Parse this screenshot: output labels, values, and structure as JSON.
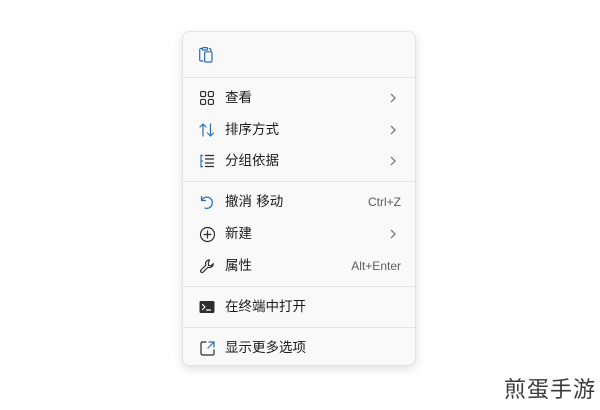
{
  "menu": {
    "quick_actions": [
      {
        "icon": "clipboard-paste-icon"
      }
    ],
    "groups": [
      [
        {
          "label": "查看",
          "icon": "grid-view-icon",
          "submenu": true
        },
        {
          "label": "排序方式",
          "icon": "sort-arrows-icon",
          "submenu": true
        },
        {
          "label": "分组依据",
          "icon": "group-list-icon",
          "submenu": true
        }
      ],
      [
        {
          "label": "撤消 移动",
          "icon": "undo-icon",
          "shortcut": "Ctrl+Z"
        },
        {
          "label": "新建",
          "icon": "new-plus-circle-icon",
          "submenu": true
        },
        {
          "label": "属性",
          "icon": "wrench-icon",
          "shortcut": "Alt+Enter"
        }
      ],
      [
        {
          "label": "在终端中打开",
          "icon": "terminal-icon"
        }
      ],
      [
        {
          "label": "显示更多选项",
          "icon": "show-more-options-icon"
        }
      ]
    ]
  },
  "colors": {
    "accent": "#2b6fb6",
    "text": "#1b1b1b",
    "shortcut": "#5c5c5c"
  },
  "watermark": {
    "text": "煎蛋手游"
  }
}
